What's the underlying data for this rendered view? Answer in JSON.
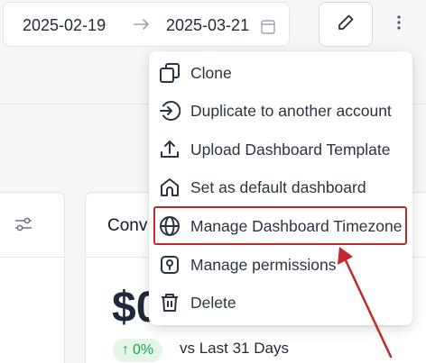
{
  "date_range": {
    "start": "2025-02-19",
    "arrow": "→",
    "end": "2025-03-21"
  },
  "menu": {
    "items": [
      {
        "label": "Clone",
        "icon": "clone-icon"
      },
      {
        "label": "Duplicate to another account",
        "icon": "duplicate-enter-icon"
      },
      {
        "label": "Upload Dashboard Template",
        "icon": "upload-icon"
      },
      {
        "label": "Set as default dashboard",
        "icon": "home-icon"
      },
      {
        "label": "Manage Dashboard Timezone",
        "icon": "globe-icon"
      },
      {
        "label": "Manage permissions",
        "icon": "lock-icon"
      },
      {
        "label": "Delete",
        "icon": "trash-icon"
      }
    ],
    "highlighted_index": 4
  },
  "card": {
    "title": "Conv",
    "value": "$0",
    "change": "0%",
    "change_arrow": "↑",
    "compare": "vs Last 31 Days"
  },
  "colors": {
    "highlight": "#c0282b",
    "positive": "#16a34a",
    "positive_bg": "#e3f6e8"
  }
}
